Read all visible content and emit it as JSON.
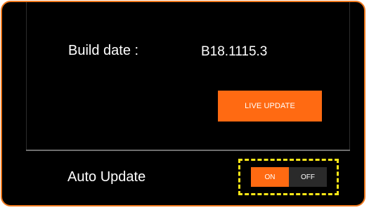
{
  "build_info": {
    "label": "Build date :",
    "value": "B18.1115.3"
  },
  "live_update": {
    "label": "LIVE UPDATE"
  },
  "auto_update": {
    "label": "Auto Update",
    "on_label": "ON",
    "off_label": "OFF",
    "selected": "ON"
  },
  "colors": {
    "frame_border": "#f07a1f",
    "accent": "#ff6a12",
    "background": "#000000",
    "highlight": "#ffe817"
  }
}
